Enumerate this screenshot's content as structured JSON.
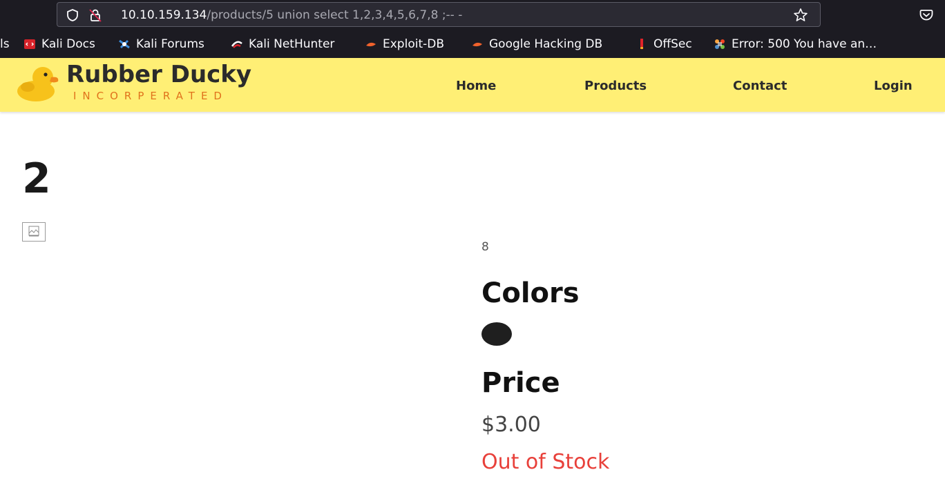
{
  "browser": {
    "url_host": "10.10.159.134",
    "url_path": "/products/5 union select 1,2,3,4,5,6,7,8 ;-- -"
  },
  "bookmarks": [
    {
      "label": "ls",
      "icon": "kali-tools-icon"
    },
    {
      "label": "Kali Docs",
      "icon": "kali-docs-icon"
    },
    {
      "label": "Kali Forums",
      "icon": "kali-forums-icon"
    },
    {
      "label": "Kali NetHunter",
      "icon": "kali-nethunter-icon"
    },
    {
      "label": "Exploit-DB",
      "icon": "exploit-db-icon"
    },
    {
      "label": "Google Hacking DB",
      "icon": "ghdb-icon"
    },
    {
      "label": "OffSec",
      "icon": "offsec-icon"
    },
    {
      "label": "Error: 500 You have an…",
      "icon": "joomla-icon"
    }
  ],
  "site": {
    "brand_name": "Rubber Ducky",
    "brand_sub": "INCORPERATED",
    "nav": [
      "Home",
      "Products",
      "Contact",
      "Login"
    ],
    "header_color": "#ffef75",
    "accent_color": "#e0721c"
  },
  "product": {
    "title": "2",
    "quantity": "8",
    "colors_heading": "Colors",
    "swatch_color": "#1f1f1f",
    "price_heading": "Price",
    "price": "$3.00",
    "stock_status": "Out of Stock",
    "stock_color": "#e8403a"
  }
}
